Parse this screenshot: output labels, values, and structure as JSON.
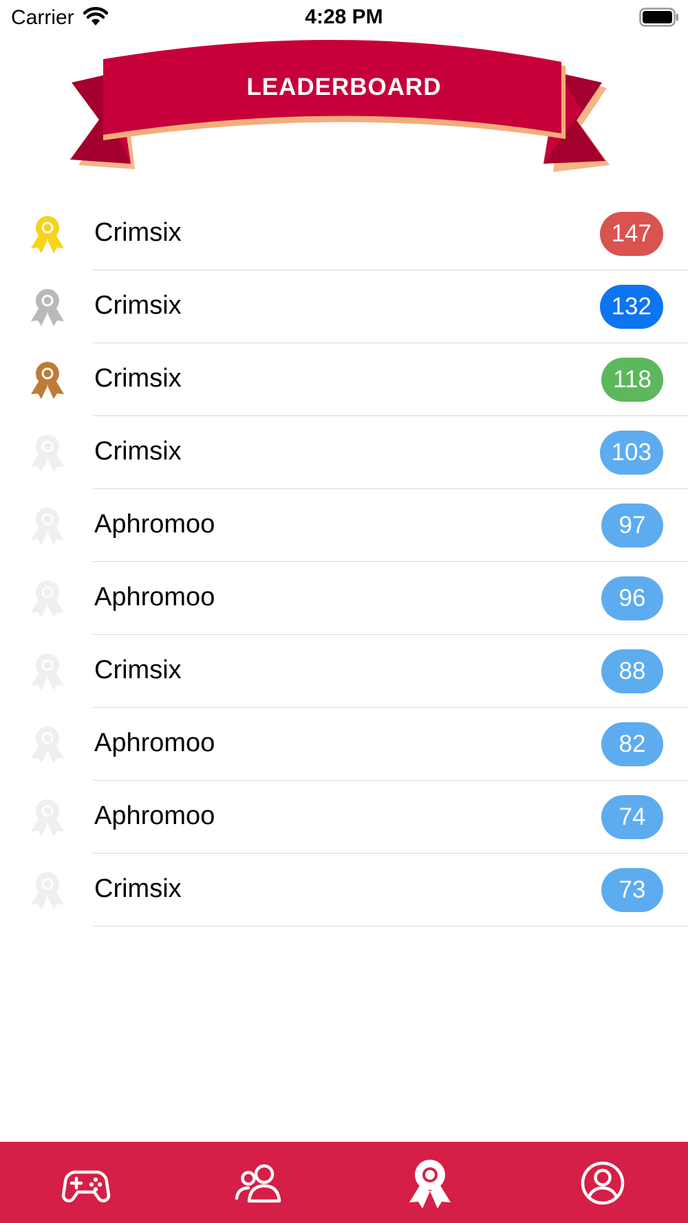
{
  "status_bar": {
    "carrier": "Carrier",
    "time": "4:28 PM"
  },
  "banner": {
    "title": "LEADERBOARD"
  },
  "colors": {
    "banner_red": "#c70039",
    "banner_dark": "#a3002e",
    "banner_shadow": "#f4ad7a",
    "tab_bar": "#d51f46",
    "gold": "#f7d31a",
    "silver": "#b9b9b9",
    "bronze": "#bf7a38",
    "faded": "#f1eeee",
    "badge_red": "#d9534f",
    "badge_blue": "#0d74f2",
    "badge_green": "#5cb85c",
    "badge_light_blue": "#5dacf0"
  },
  "leaderboard": [
    {
      "name": "Crimsix",
      "score": "147",
      "medal": "gold-medal-icon"
    },
    {
      "name": "Crimsix",
      "score": "132",
      "medal": "silver-medal-icon"
    },
    {
      "name": "Crimsix",
      "score": "118",
      "medal": "bronze-medal-icon"
    },
    {
      "name": "Crimsix",
      "score": "103",
      "medal": "faded-medal-icon"
    },
    {
      "name": "Aphromoo",
      "score": "97",
      "medal": "faded-medal-icon"
    },
    {
      "name": "Aphromoo",
      "score": "96",
      "medal": "faded-medal-icon"
    },
    {
      "name": "Crimsix",
      "score": "88",
      "medal": "faded-medal-icon"
    },
    {
      "name": "Aphromoo",
      "score": "82",
      "medal": "faded-medal-icon"
    },
    {
      "name": "Aphromoo",
      "score": "74",
      "medal": "faded-medal-icon"
    },
    {
      "name": "Crimsix",
      "score": "73",
      "medal": "faded-medal-icon"
    }
  ],
  "tab_bar": {
    "items": [
      {
        "icon": "gamepad-icon",
        "selected": false
      },
      {
        "icon": "friends-icon",
        "selected": false
      },
      {
        "icon": "medal-icon",
        "selected": true
      },
      {
        "icon": "profile-icon",
        "selected": false
      }
    ]
  }
}
